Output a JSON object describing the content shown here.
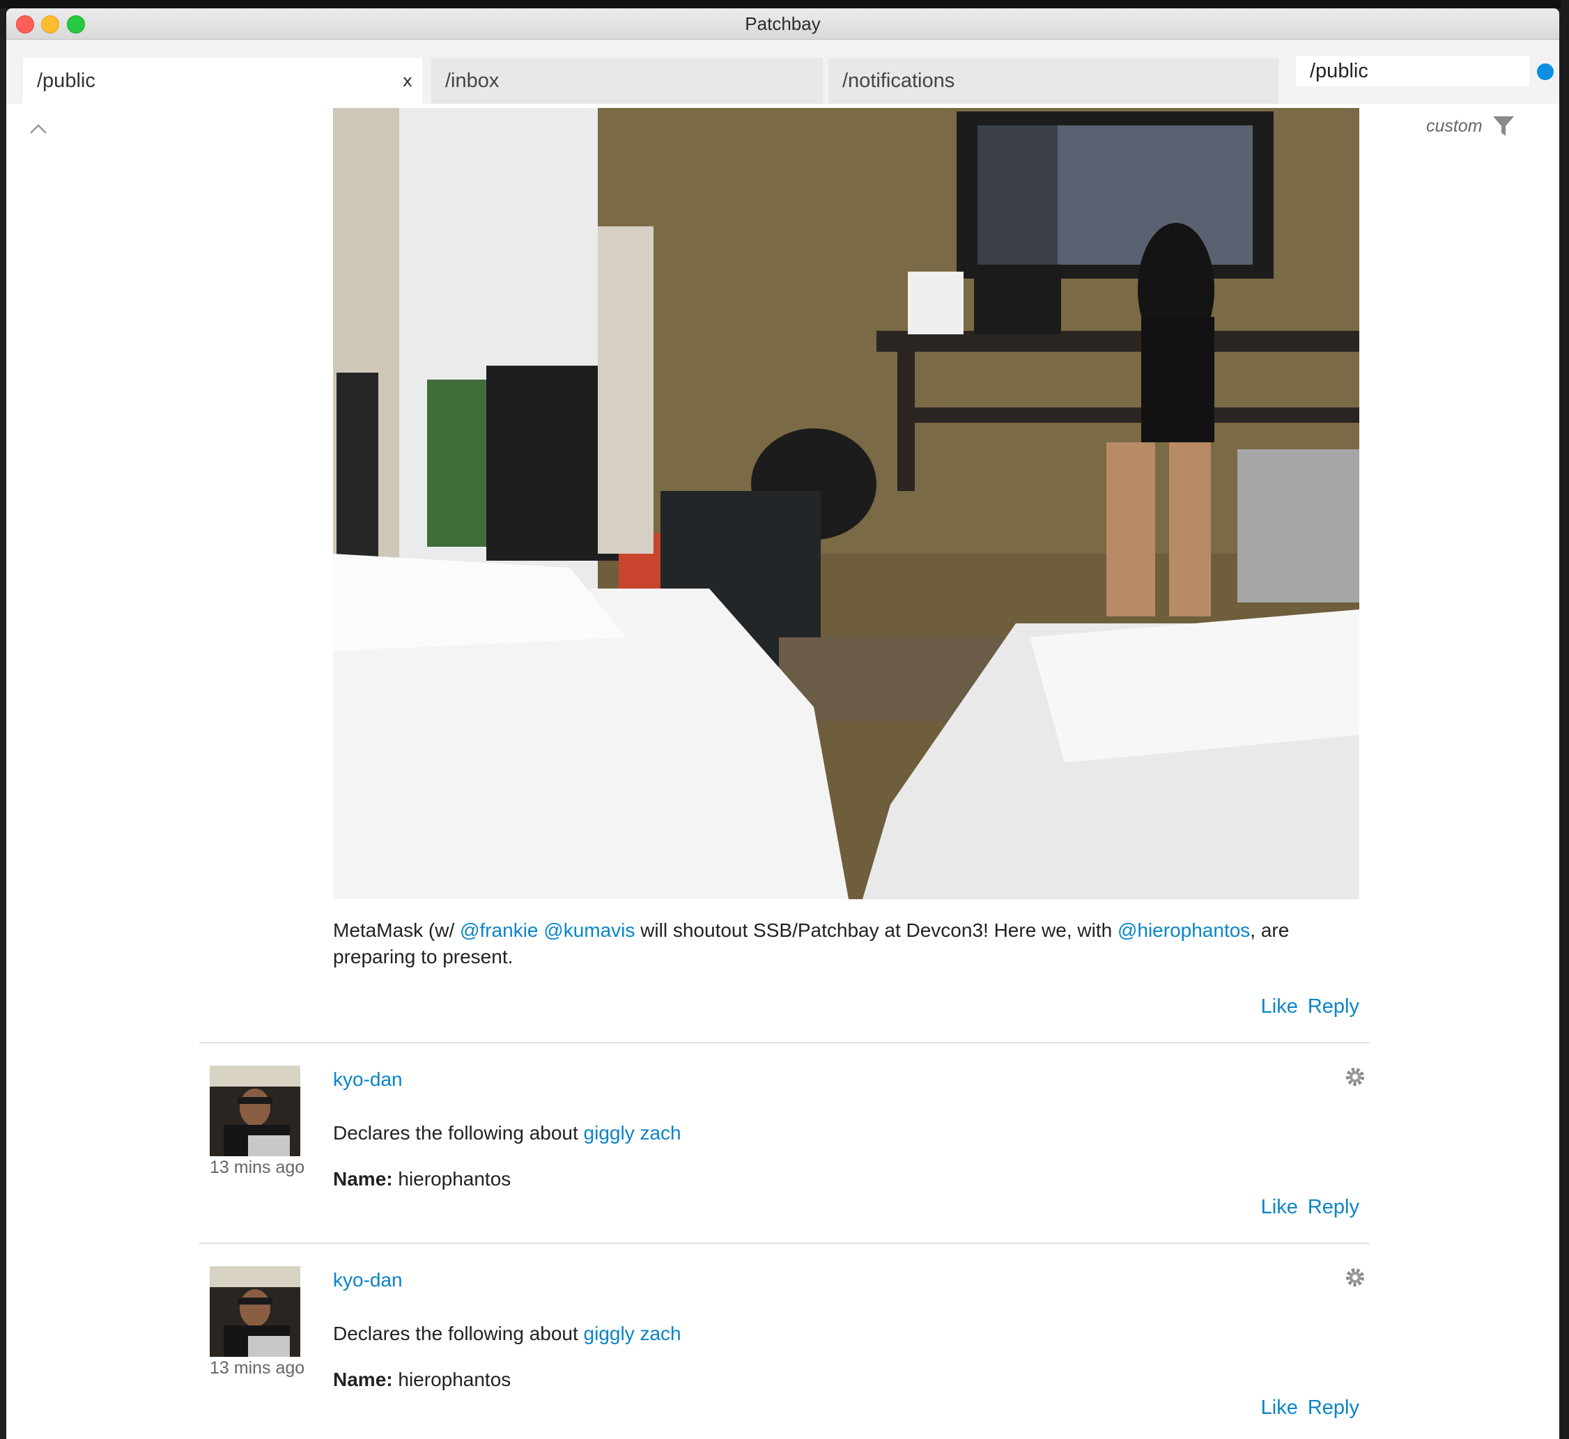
{
  "window": {
    "title": "Patchbay"
  },
  "tabs": [
    {
      "label": "/public",
      "close": "x"
    },
    {
      "label": "/inbox"
    },
    {
      "label": "/notifications"
    }
  ],
  "search": {
    "value": "/public"
  },
  "filter": {
    "label": "custom"
  },
  "post": {
    "text_pre": "MetaMask (w/ ",
    "mention_1": "@frankie",
    "mention_2": "@kumavis",
    "text_mid": " will shoutout SSB/Patchbay at Devcon3! Here we, with ",
    "mention_3": "@hierophantos",
    "text_post": ", are preparing to present.",
    "like": "Like",
    "reply": "Reply"
  },
  "messages": [
    {
      "author": "kyo-dan",
      "time": "13 mins ago",
      "declares": "Declares the following about ",
      "subject": "giggly zach",
      "name_label": "Name:",
      "name_value": " hierophantos",
      "like": "Like",
      "reply": "Reply"
    },
    {
      "author": "kyo-dan",
      "time": "13 mins ago",
      "declares": "Declares the following about ",
      "subject": "giggly zach",
      "name_label": "Name:",
      "name_value": " hierophantos",
      "like": "Like",
      "reply": "Reply"
    }
  ],
  "colors": {
    "link": "#0a84c7",
    "status_dot": "#0d8fe0"
  }
}
